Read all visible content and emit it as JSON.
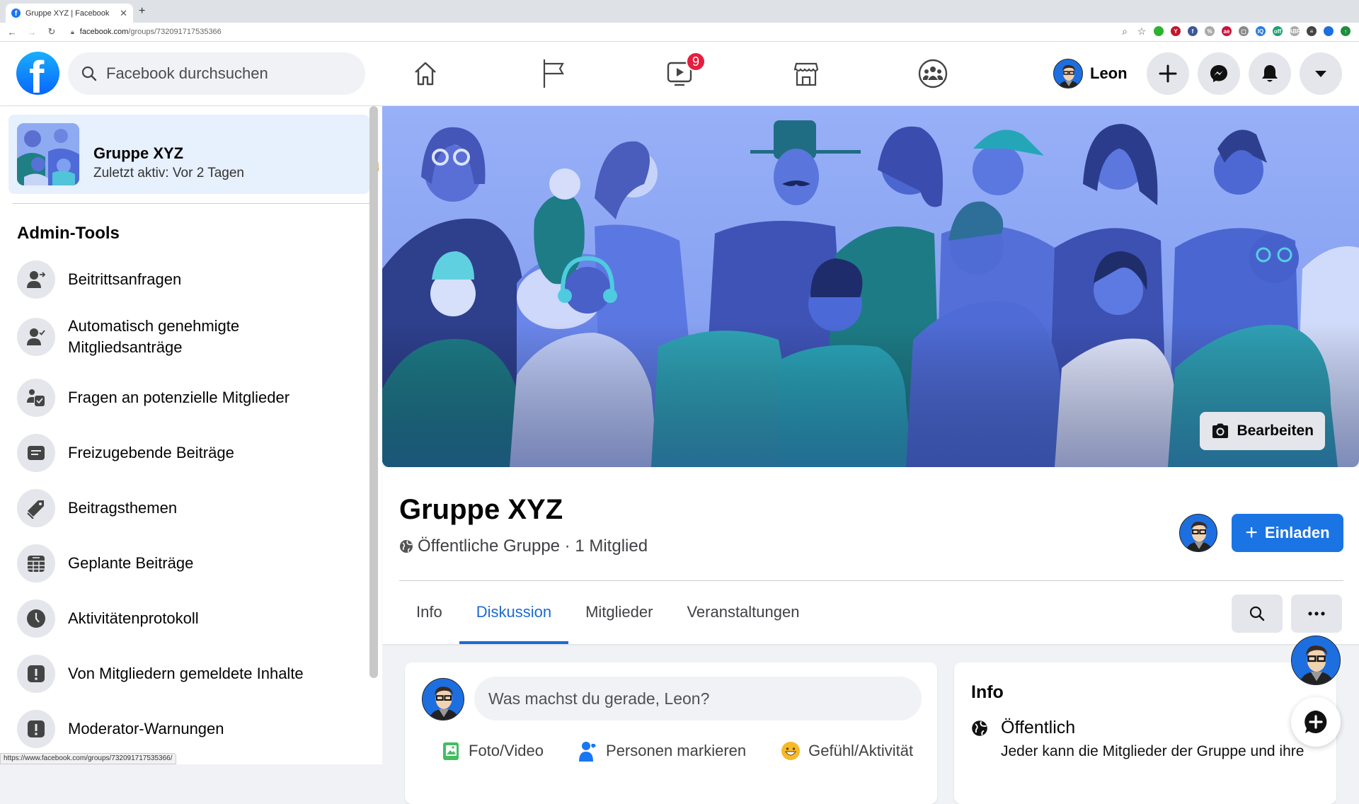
{
  "browser": {
    "tab_title": "Gruppe XYZ | Facebook",
    "url_domain": "facebook.com",
    "url_path": "/groups/732091717535366",
    "status_url": "https://www.facebook.com/groups/732091717535366/",
    "extensions": [
      {
        "name": "zoom-icon",
        "color": "#666666",
        "glyph": "⌕"
      },
      {
        "name": "bookmark-star-icon",
        "color": "#555555",
        "glyph": "☆"
      },
      {
        "name": "ext-green-icon",
        "color": "#2bb32b",
        "glyph": ""
      },
      {
        "name": "ext-yab-icon",
        "color": "#c0172b",
        "glyph": "Y"
      },
      {
        "name": "ext-facebook-icon",
        "color": "#3b5998",
        "glyph": "f"
      },
      {
        "name": "ext-gray-icon",
        "color": "#aaaaaa",
        "glyph": "%"
      },
      {
        "name": "ext-ae-icon",
        "color": "#c8143c",
        "glyph": "ae"
      },
      {
        "name": "ext-screen-icon",
        "color": "#888888",
        "glyph": "▢"
      },
      {
        "name": "ext-iq-icon",
        "color": "#2a7de1",
        "glyph": "IQ"
      },
      {
        "name": "ext-off-icon",
        "color": "#1ba36b",
        "glyph": "off"
      },
      {
        "name": "ext-abp-icon",
        "color": "#aaaaaa",
        "glyph": "ABP"
      },
      {
        "name": "media-control-icon",
        "color": "#444444",
        "glyph": "≡"
      },
      {
        "name": "browser-profile-icon",
        "color": "#1d6fe0",
        "glyph": ""
      },
      {
        "name": "ext-update-icon",
        "color": "#1e8e3e",
        "glyph": "↑"
      }
    ]
  },
  "header": {
    "search_placeholder": "Facebook durchsuchen",
    "watch_badge": "9",
    "user_name": "Leon"
  },
  "sidebar": {
    "group": {
      "name": "Gruppe XYZ",
      "last_active": "Zuletzt aktiv: Vor 2 Tagen"
    },
    "section_title": "Admin-Tools",
    "items": [
      {
        "label": "Beitrittsanfragen",
        "icon": "member-request-icon"
      },
      {
        "label": "Automatisch genehmigte Mitgliedsanträge",
        "icon": "auto-approve-icon"
      },
      {
        "label": "Fragen an potenzielle Mitglieder",
        "icon": "membership-questions-icon"
      },
      {
        "label": "Freizugebende Beiträge",
        "icon": "pending-posts-icon"
      },
      {
        "label": "Beitragsthemen",
        "icon": "post-topics-icon"
      },
      {
        "label": "Geplante Beiträge",
        "icon": "scheduled-posts-icon"
      },
      {
        "label": "Aktivitätenprotokoll",
        "icon": "activity-log-icon"
      },
      {
        "label": "Von Mitgliedern gemeldete Inhalte",
        "icon": "member-reported-icon"
      },
      {
        "label": "Moderator-Warnungen",
        "icon": "moderator-alerts-icon"
      }
    ]
  },
  "group": {
    "title": "Gruppe XYZ",
    "privacy": "Öffentliche Gruppe",
    "separator": " · ",
    "members": "1 Mitglied",
    "edit_cover_label": "Bearbeiten",
    "invite_label": "Einladen",
    "tabs": [
      {
        "label": "Info",
        "active": false
      },
      {
        "label": "Diskussion",
        "active": true
      },
      {
        "label": "Mitglieder",
        "active": false
      },
      {
        "label": "Veranstaltungen",
        "active": false
      }
    ]
  },
  "composer": {
    "placeholder": "Was machst du gerade, Leon?",
    "actions": [
      {
        "label": "Foto/Video",
        "color": "#45bd62"
      },
      {
        "label": "Personen markieren",
        "color": "#1877f2"
      },
      {
        "label": "Gefühl/Aktivität",
        "color": "#f7b928"
      }
    ]
  },
  "info_card": {
    "title": "Info",
    "privacy_heading": "Öffentlich",
    "privacy_desc": "Jeder kann die Mitglieder der Gruppe und ihre"
  },
  "colors": {
    "brand_blue": "#1877f2",
    "active_tab": "#1b6ad4",
    "badge_red": "#e41e3f"
  }
}
